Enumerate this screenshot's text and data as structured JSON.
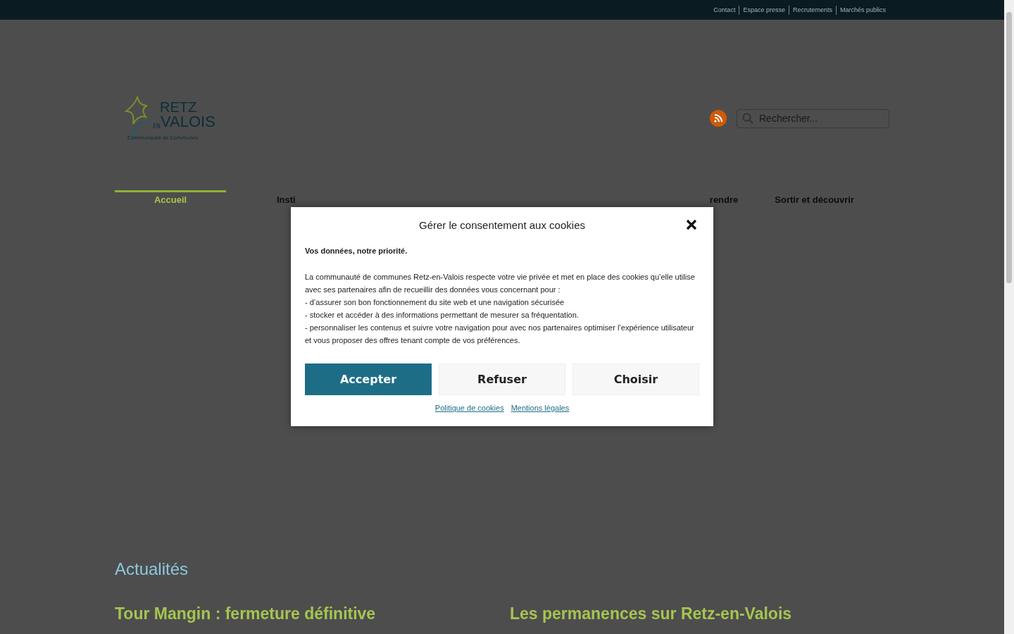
{
  "top_links": [
    "Contact",
    "Espace presse",
    "Recrutements",
    "Marchés publics"
  ],
  "logo": {
    "line1": "RETZ",
    "small": "EN",
    "line2": "VALOIS",
    "tagline": "Communauté de Communes"
  },
  "search": {
    "placeholder": "Rechercher..."
  },
  "nav": {
    "items": [
      {
        "label": "Accueil",
        "selected": true
      },
      {
        "label": "Insti",
        "selected": false
      },
      {
        "label": "rendre",
        "selected": false
      },
      {
        "label": "Sortir et découvrir",
        "selected": false
      }
    ]
  },
  "news": {
    "heading": "Actualités",
    "articles": [
      "Tour Mangin : fermeture définitive",
      "Les permanences sur Retz-en-Valois"
    ]
  },
  "cookie_dialog": {
    "title": "Gérer le consentement aux cookies",
    "lead": "Vos données, notre priorité.",
    "intro": "La communauté de communes Retz-en-Valois respecte votre vie privée et met en place des cookies qu’elle utilise avec ses partenaires afin de recueillir des données vous concernant pour :",
    "points": [
      "- d’assurer son bon fonctionnement du site web et une navigation sécurisée",
      "- stocker et accéder à des informations permettant de mesurer sa fréquentation.",
      "- personnaliser les contenus et suivre votre navigation pour avec nos partenaires optimiser l’expérience utilisateur et vous proposer des offres tenant compte de vos préférences."
    ],
    "buttons": [
      {
        "label": "Accepter",
        "kind": "primary"
      },
      {
        "label": "Refuser",
        "kind": "secondary"
      },
      {
        "label": "Choisir",
        "kind": "secondary"
      }
    ],
    "links": [
      "Politique de cookies",
      "Mentions légales"
    ]
  }
}
